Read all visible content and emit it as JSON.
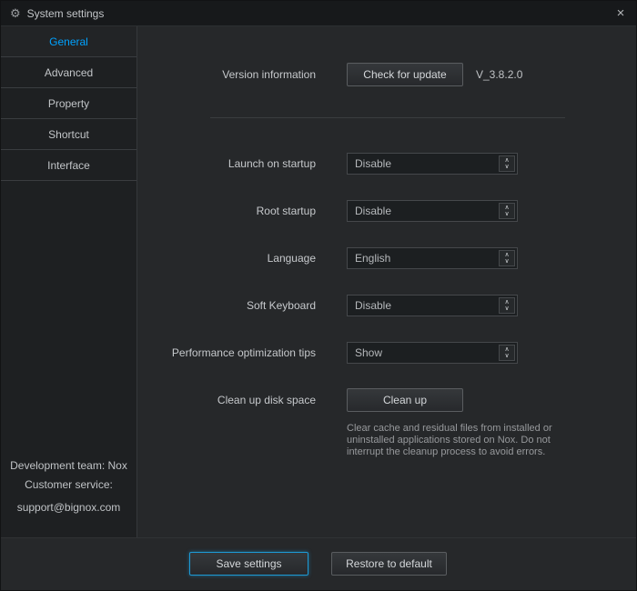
{
  "icons": {
    "gear": "⚙",
    "close": "×",
    "chevron_up": "∧",
    "chevron_down": "∨"
  },
  "window": {
    "title": "System settings"
  },
  "sidebar": {
    "tabs": [
      {
        "label": "General",
        "active": true
      },
      {
        "label": "Advanced",
        "active": false
      },
      {
        "label": "Property",
        "active": false
      },
      {
        "label": "Shortcut",
        "active": false
      },
      {
        "label": "Interface",
        "active": false
      }
    ],
    "footer": {
      "line1": "Development team: Nox",
      "line2": "Customer service:",
      "line3": "support@bignox.com"
    }
  },
  "content": {
    "version": {
      "label": "Version information",
      "button": "Check for update",
      "value": "V_3.8.2.0"
    },
    "rows": [
      {
        "label": "Launch on startup",
        "value": "Disable"
      },
      {
        "label": "Root startup",
        "value": "Disable"
      },
      {
        "label": "Language",
        "value": "English"
      },
      {
        "label": "Soft Keyboard",
        "value": "Disable"
      },
      {
        "label": "Performance optimization tips",
        "value": "Show"
      }
    ],
    "cleanup": {
      "label": "Clean up disk space",
      "button": "Clean up",
      "description": "Clear cache and residual files from installed or uninstalled applications stored on Nox. Do not interrupt the cleanup process to avoid errors."
    }
  },
  "footer": {
    "save_button": "Save settings",
    "restore_button": "Restore to default"
  },
  "colors": {
    "accent": "#00a2ff"
  }
}
